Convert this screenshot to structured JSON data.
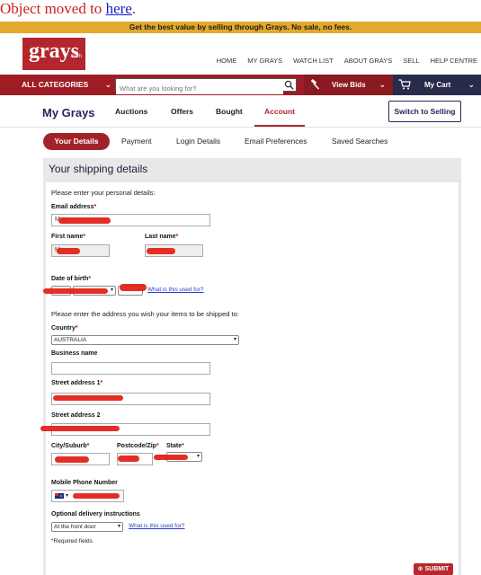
{
  "browser_notice": {
    "text": "Object moved to ",
    "link": "here",
    "suffix": "."
  },
  "promo": "Get the best value by selling through Grays. No sale, no fees.",
  "logo": {
    "name": "grays",
    "suffix": ".com"
  },
  "top_nav": [
    "HOME",
    "MY GRAYS",
    "WATCH LIST",
    "ABOUT GRAYS",
    "SELL",
    "HELP CENTRE"
  ],
  "main_bar": {
    "all_categories": "ALL CATEGORIES",
    "search_placeholder": "What are you looking for?",
    "view_bids": "View Bids",
    "my_cart": "My Cart",
    "colors": {
      "bar": "#9e1c24",
      "bids": "#8a1920",
      "cart": "#282b4a"
    }
  },
  "sub_nav": {
    "title": "My Grays",
    "items": [
      "Auctions",
      "Offers",
      "Bought",
      "Account"
    ],
    "active": "Account",
    "switch_button": "Switch to Selling"
  },
  "tabs": {
    "items": [
      "Your Details",
      "Payment",
      "Login Details",
      "Email Preferences",
      "Saved Searches"
    ],
    "active": "Your Details"
  },
  "form": {
    "heading": "Your shipping details",
    "intro": "Please enter your personal details:",
    "email_label": "Email address",
    "email_value": "M                    au",
    "first_name_label": "First name",
    "first_name_value": "M",
    "last_name_label": "Last name",
    "dob_label": "Date of birth",
    "dob_link": "What is this used for?",
    "address_intro": "Please enter the address you wish your items to be shipped to:",
    "country_label": "Country",
    "country_value": "AUSTRALIA",
    "business_label": "Business name",
    "street1_label": "Street address 1",
    "street2_label": "Street address 2",
    "city_label": "City/Suburb",
    "postcode_label": "Postcode/Zip",
    "state_label": "State",
    "mobile_label": "Mobile Phone Number",
    "delivery_label": "Optional delivery instructions",
    "delivery_value": "At the front door",
    "delivery_link": "What is this used for?",
    "required_note": "*Required fields",
    "submit": "SUBMIT",
    "required_marker": "*"
  }
}
